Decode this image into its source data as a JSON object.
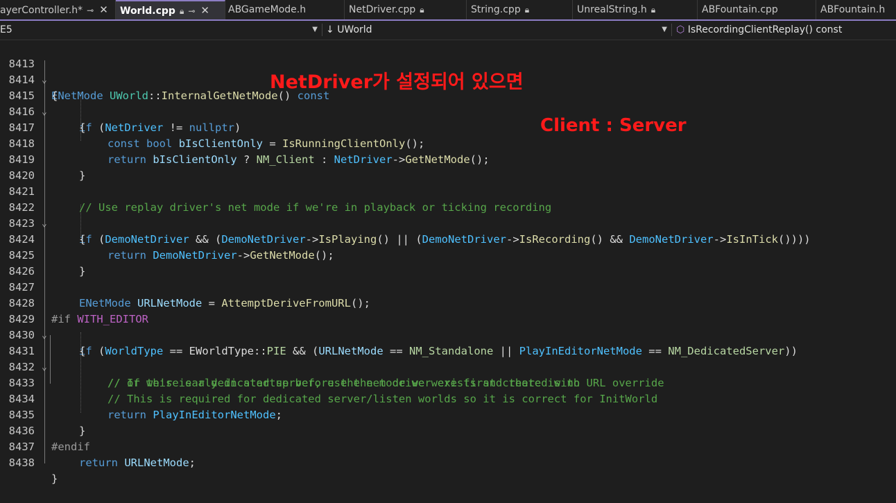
{
  "tabs": [
    {
      "label": "ayerController.h*",
      "icons": [
        "pin-icon",
        "close-icon"
      ],
      "active": false
    },
    {
      "label": "World.cpp",
      "icons": [
        "lock-icon",
        "pin-icon",
        "close-icon"
      ],
      "active": true
    },
    {
      "label": "ABGameMode.h",
      "icons": [],
      "active": false
    },
    {
      "label": "NetDriver.cpp",
      "icons": [
        "lock-icon"
      ],
      "active": false
    },
    {
      "label": "String.cpp",
      "icons": [
        "lock-icon"
      ],
      "active": false
    },
    {
      "label": "UnrealString.h",
      "icons": [
        "lock-icon"
      ],
      "active": false
    },
    {
      "label": "ABFountain.cpp",
      "icons": [],
      "active": false
    },
    {
      "label": "ABFountain.h",
      "icons": [],
      "active": false
    }
  ],
  "nav": {
    "project": "E5",
    "scope_prefix": "↓",
    "scope": "UWorld",
    "member": "IsRecordingClientReplay() const"
  },
  "line_numbers": [
    "8413",
    "8414",
    "8415",
    "8416",
    "8417",
    "8418",
    "8419",
    "8420",
    "8421",
    "8422",
    "8423",
    "8424",
    "8425",
    "8426",
    "8427",
    "8428",
    "8429",
    "8430",
    "8431",
    "8432",
    "8433",
    "8434",
    "8435",
    "8436",
    "8437",
    "8438"
  ],
  "code": {
    "l8413": [
      "ENetMode",
      " ",
      "UWorld",
      "::",
      "InternalGetNetMode",
      "() ",
      "const"
    ],
    "l8414": [
      "{"
    ],
    "l8415": [
      "if",
      " (",
      "NetDriver",
      " != ",
      "nullptr",
      ")"
    ],
    "l8416": [
      "{"
    ],
    "l8417": [
      "const",
      " ",
      "bool",
      " ",
      "bIsClientOnly",
      " = ",
      "IsRunningClientOnly",
      "();"
    ],
    "l8418": [
      "return",
      " ",
      "bIsClientOnly",
      " ? ",
      "NM_Client",
      " : ",
      "NetDriver",
      "->",
      "GetNetMode",
      "();"
    ],
    "l8419": [
      "}"
    ],
    "l8421": [
      "// Use replay driver's net mode if we're in playback or ticking recording"
    ],
    "l8422": [
      "if",
      " (",
      "DemoNetDriver",
      " && (",
      "DemoNetDriver",
      "->",
      "IsPlaying",
      "() || (",
      "DemoNetDriver",
      "->",
      "IsRecording",
      "() && ",
      "DemoNetDriver",
      "->",
      "IsInTick",
      "())))"
    ],
    "l8423": [
      "{"
    ],
    "l8424": [
      "return",
      " ",
      "DemoNetDriver",
      "->",
      "GetNetMode",
      "();"
    ],
    "l8425": [
      "}"
    ],
    "l8427": [
      "ENetMode",
      " ",
      "URLNetMode",
      " = ",
      "AttemptDeriveFromURL",
      "();"
    ],
    "l8428": [
      "#if",
      " ",
      "WITH_EDITOR"
    ],
    "l8429": [
      "if",
      " (",
      "WorldType",
      " == ",
      "EWorldType",
      "::",
      "PIE",
      " && (",
      "URLNetMode",
      " == ",
      "NM_Standalone",
      " || ",
      "PlayInEditorNetMode",
      " == ",
      "NM_DedicatedServer",
      "))"
    ],
    "l8430": [
      "{"
    ],
    "l8431": [
      "// If we're early in startup before the net driver exists and there is no URL override"
    ],
    "l8432": [
      "// or this is a dedicated server, use the mode we were first created with"
    ],
    "l8433": [
      "// This is required for dedicated server/listen worlds so it is correct for InitWorld"
    ],
    "l8434": [
      "return",
      " ",
      "PlayInEditorNetMode",
      ";"
    ],
    "l8435": [
      "}"
    ],
    "l8436": [
      "#endif"
    ],
    "l8437": [
      "return",
      " ",
      "URLNetMode",
      ";"
    ],
    "l8438": [
      "}"
    ]
  },
  "annotations": {
    "note1": "NetDriver가 설정되어 있으면",
    "note2": "Client : Server"
  },
  "colors": {
    "keyword": "#569cd6",
    "type": "#4ec9b0",
    "function": "#dcdcaa",
    "variable": "#9cdcfe",
    "member": "#4fc1ff",
    "enum": "#b8d7a3",
    "comment": "#57a64a",
    "macro": "#bd63c5",
    "annotation": "#ff1a1a",
    "accent": "#8c7dc4"
  }
}
